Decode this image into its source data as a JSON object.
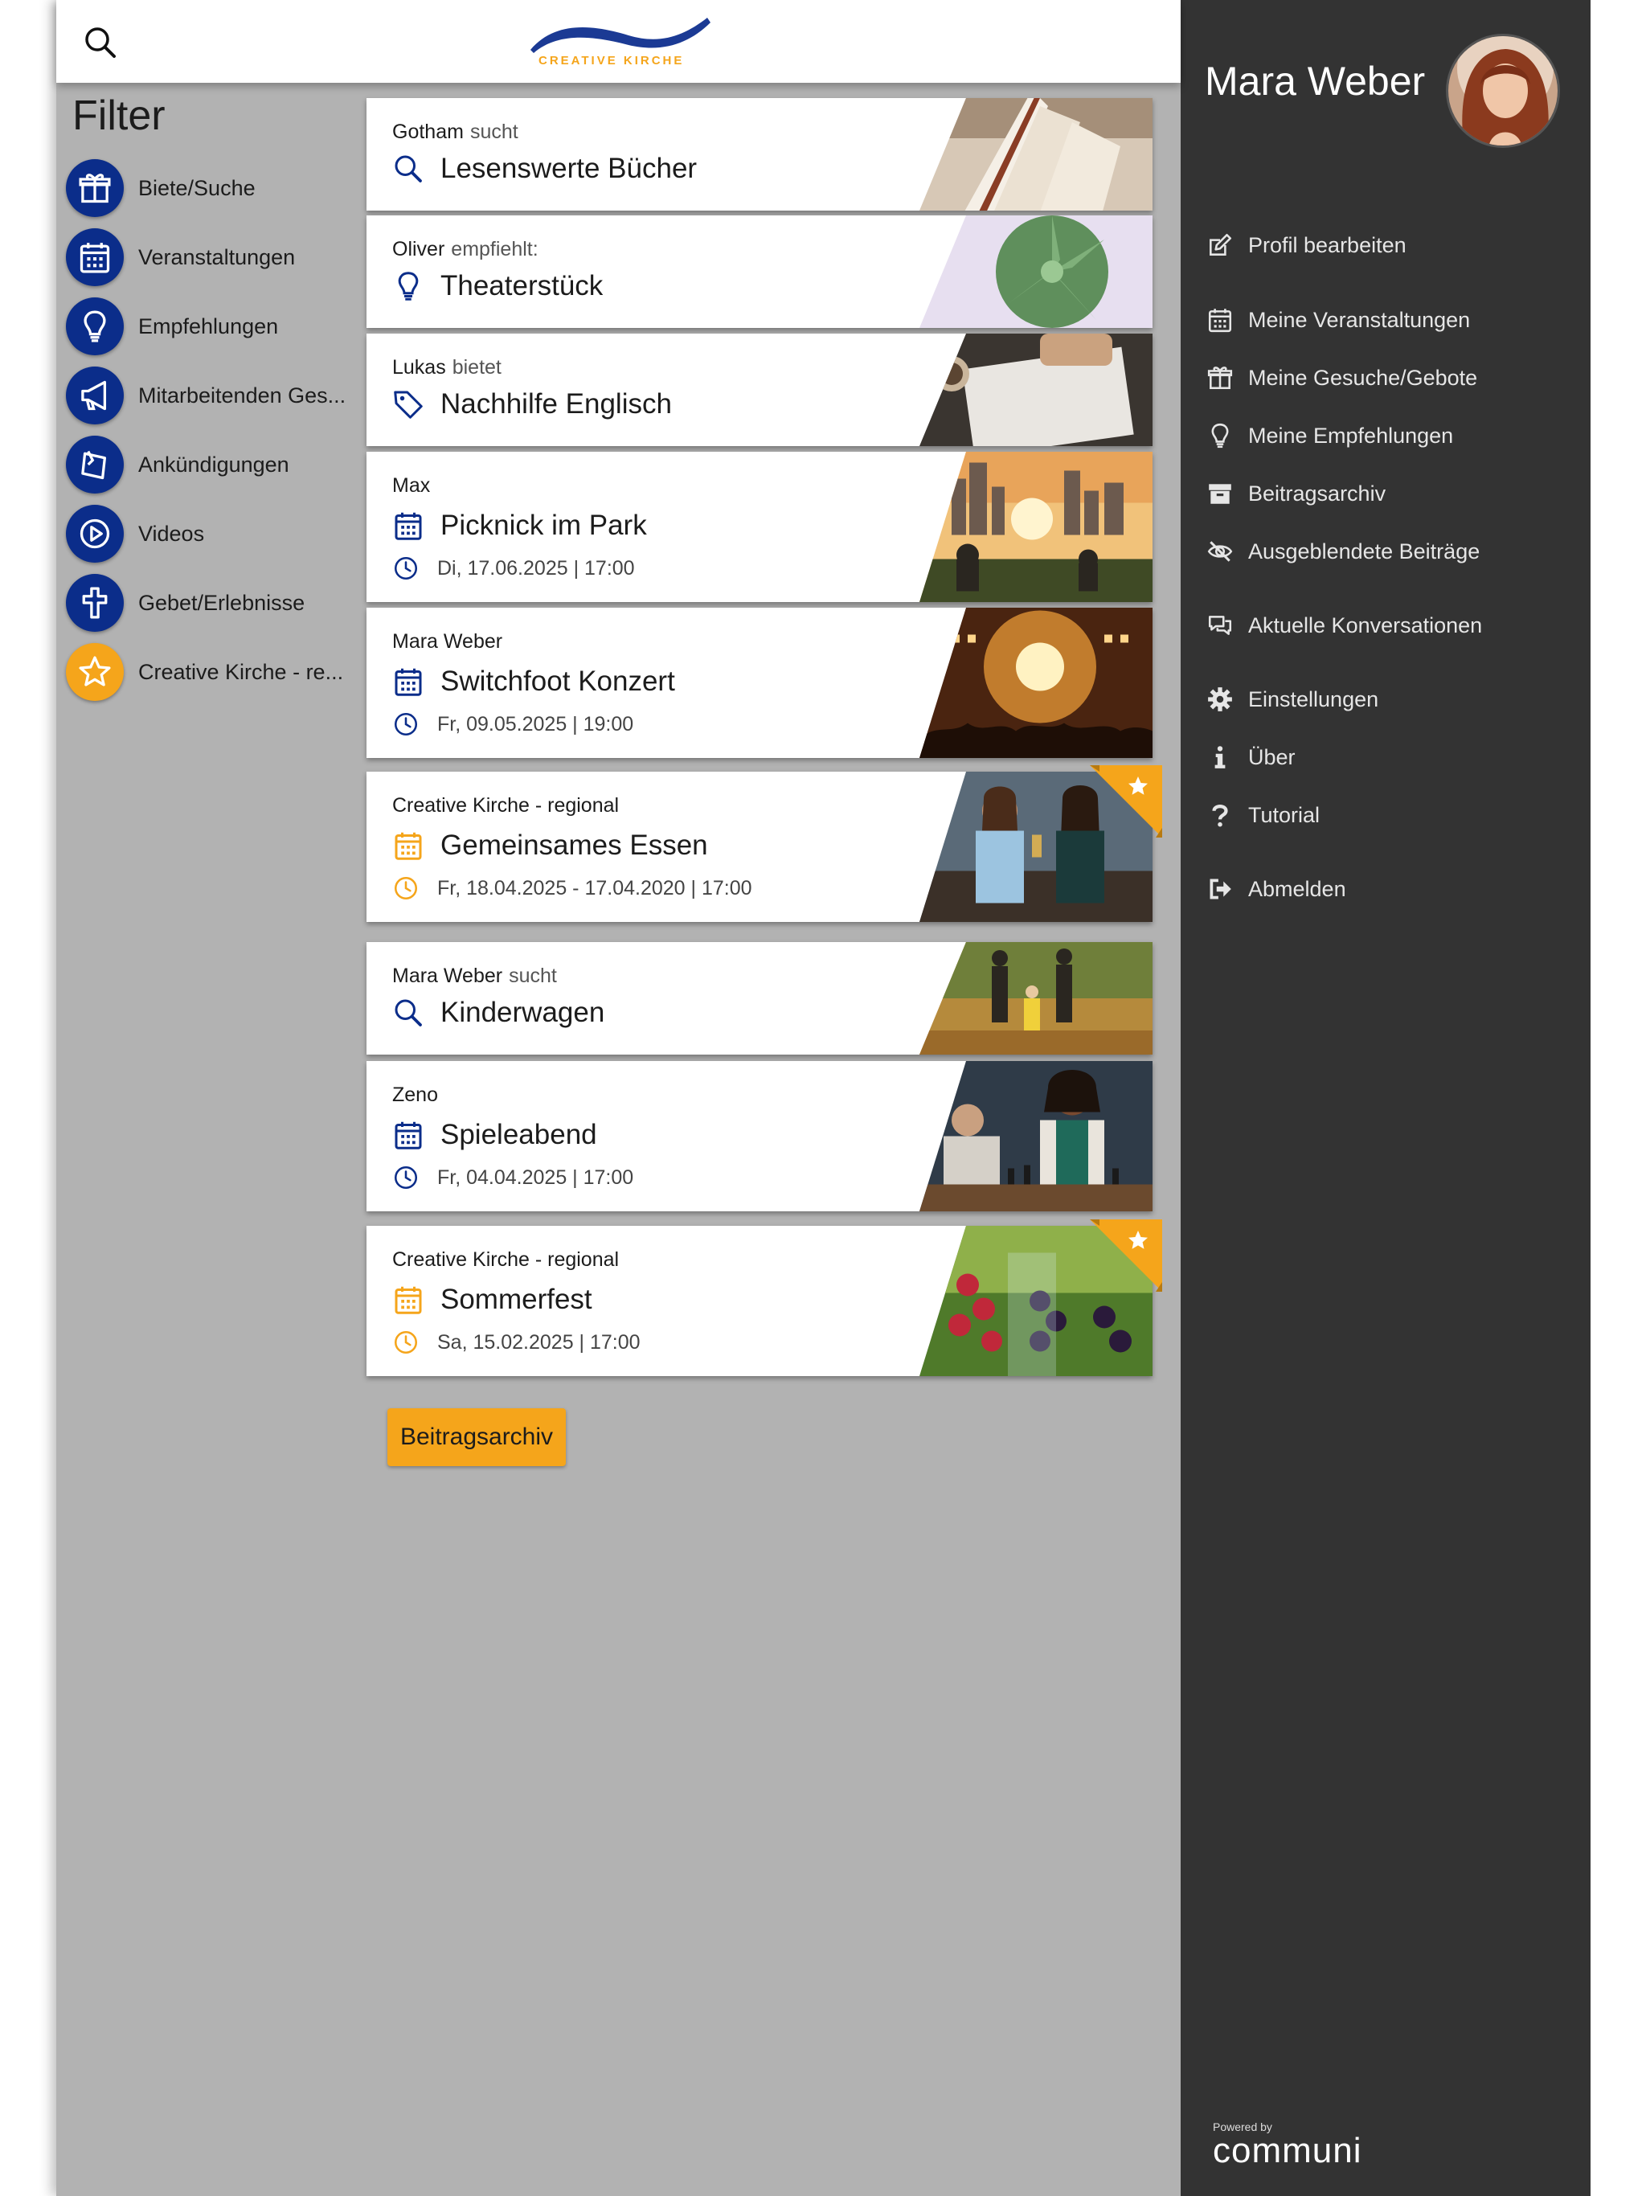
{
  "header": {
    "logo_text": "CREATIVE KIRCHE"
  },
  "filter": {
    "title": "Filter",
    "items": [
      {
        "label": "Biete/Suche",
        "icon": "gift-icon"
      },
      {
        "label": "Veranstaltungen",
        "icon": "calendar-icon"
      },
      {
        "label": "Empfehlungen",
        "icon": "lightbulb-icon"
      },
      {
        "label": "Mitarbeitenden Ges...",
        "icon": "megaphone-icon"
      },
      {
        "label": "Ankündigungen",
        "icon": "announcement-icon"
      },
      {
        "label": "Videos",
        "icon": "play-icon"
      },
      {
        "label": "Gebet/Erlebnisse",
        "icon": "cross-icon"
      },
      {
        "label": "Creative Kirche - re...",
        "icon": "star-icon"
      }
    ]
  },
  "posts": [
    {
      "author": "Gotham",
      "verb": "sucht",
      "title": "Lesenswerte Bücher",
      "icon": "search-icon",
      "date": "",
      "image": "open-book"
    },
    {
      "author": "Oliver",
      "verb": "empfiehlt:",
      "title": "Theaterstück",
      "icon": "lightbulb-icon",
      "date": "",
      "image": "succulent"
    },
    {
      "author": "Lukas",
      "verb": "bietet",
      "title": "Nachhilfe Englisch",
      "icon": "tag-icon",
      "date": "",
      "image": "writing-desk"
    },
    {
      "author": "Max",
      "verb": "",
      "title": "Picknick im Park",
      "icon": "calendar-icon",
      "date": "Di, 17.06.2025 | 17:00",
      "image": "city-picnic"
    },
    {
      "author": "Mara Weber",
      "verb": "",
      "title": "Switchfoot Konzert",
      "icon": "calendar-icon",
      "date": "Fr, 09.05.2025 | 19:00",
      "image": "concert"
    },
    {
      "author": "Creative Kirche - regional",
      "verb": "",
      "title": "Gemeinsames Essen",
      "icon": "calendar-icon",
      "date": "Fr, 18.04.2025 - 17.04.2020 | 17:00",
      "image": "friends-drinks",
      "featured": true
    },
    {
      "author": "Mara Weber",
      "verb": "sucht",
      "title": "Kinderwagen",
      "icon": "search-icon",
      "date": "",
      "image": "family-walk"
    },
    {
      "author": "Zeno",
      "verb": "",
      "title": "Spieleabend",
      "icon": "calendar-icon",
      "date": "Fr, 04.04.2025 | 17:00",
      "image": "chess-game"
    },
    {
      "author": "Creative Kirche - regional",
      "verb": "",
      "title": "Sommerfest",
      "icon": "calendar-icon",
      "date": "Sa, 15.02.2025 | 17:00",
      "image": "berries",
      "featured": true
    }
  ],
  "archive_button": "Beitragsarchiv",
  "sidebar": {
    "user_name": "Mara Weber",
    "menu": [
      {
        "label": "Profil bearbeiten",
        "icon": "edit-icon"
      },
      {
        "label": "Meine Veranstaltungen",
        "icon": "calendar-icon"
      },
      {
        "label": "Meine Gesuche/Gebote",
        "icon": "gift-icon"
      },
      {
        "label": "Meine Empfehlungen",
        "icon": "lightbulb-icon"
      },
      {
        "label": "Beitragsarchiv",
        "icon": "archive-icon"
      },
      {
        "label": "Ausgeblendete Beiträge",
        "icon": "eye-slash-icon"
      },
      {
        "label": "Aktuelle Konversationen",
        "icon": "chat-icon"
      },
      {
        "label": "Einstellungen",
        "icon": "gear-icon"
      },
      {
        "label": "Über",
        "icon": "info-icon"
      },
      {
        "label": "Tutorial",
        "icon": "question-icon"
      },
      {
        "label": "Abmelden",
        "icon": "logout-icon"
      }
    ],
    "powered_by": "Powered by",
    "powered_logo": "communi"
  },
  "colors": {
    "brand_blue": "#0b2d8a",
    "accent_gold": "#f5a51b",
    "sidebar_bg": "#333333",
    "main_bg": "#b2b2b2"
  }
}
